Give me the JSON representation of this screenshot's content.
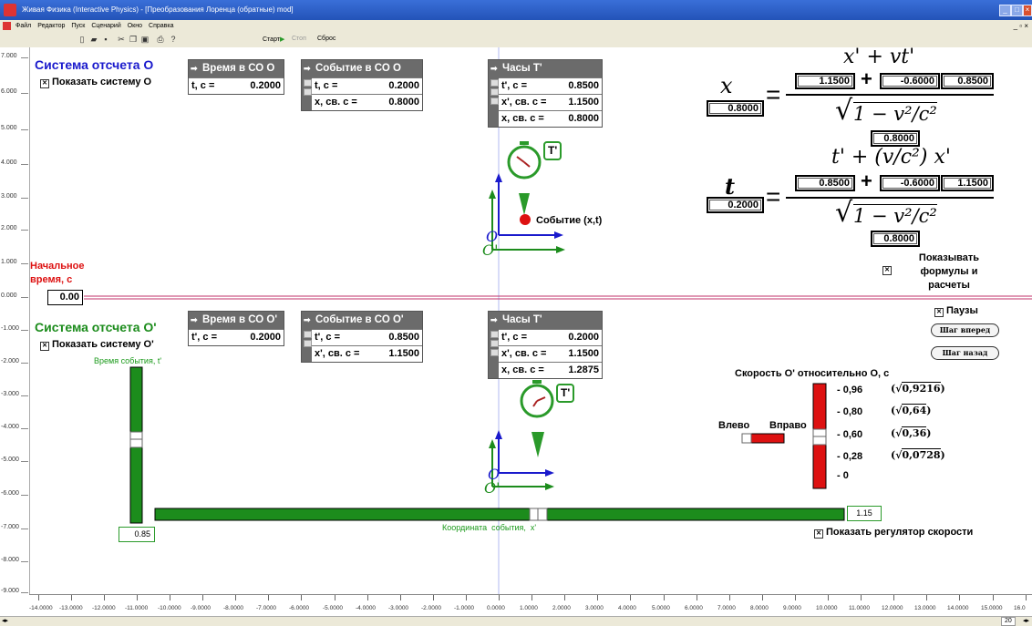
{
  "window": {
    "title": "Живая Физика (Interactive Physics) - [Преобразования Лоренца (обратные) mod]"
  },
  "menu": [
    "Файл",
    "Редактор",
    "Пуск",
    "Сценарий",
    "Окно",
    "Справка"
  ],
  "toolbar": {
    "start": "Старт",
    "stop": "Стоп",
    "reset": "Сброс"
  },
  "frame_o": {
    "heading": "Система отсчета O",
    "show_label": "Показать систему O",
    "time_meter": {
      "title": "Время в СО O",
      "label": "t, c =",
      "value": "0.2000"
    },
    "event_meter": {
      "title": "Событие в СО O",
      "rows": [
        {
          "label": "t, c =",
          "value": "0.2000"
        },
        {
          "label": "x, св. с =",
          "value": "0.8000"
        }
      ]
    },
    "clock_meter": {
      "title": "Часы T'",
      "rows": [
        {
          "label": "t', c =",
          "value": "0.8500"
        },
        {
          "label": "x', св. с =",
          "value": "1.1500"
        },
        {
          "label": "x, св. с =",
          "value": "0.8000"
        }
      ]
    },
    "clock_label": "T'",
    "event_label": "Событие (x,t)",
    "axis_o": "O",
    "axis_o_prime": "O'"
  },
  "formulas": {
    "x_var": "x",
    "x_result": "0.8000",
    "x_numerator": "x' + vt'",
    "x_n1": "1.1500",
    "x_n2": "-0.6000",
    "x_n3": "0.8500",
    "x_den_val": "0.8000",
    "t_var": "t",
    "t_result": "0.2000",
    "t_numerator": "t' + (v/c²) x'",
    "t_n1": "0.8500",
    "t_n2": "-0.6000",
    "t_n3": "1.1500",
    "t_den_val": "0.8000",
    "denominator": "1 − v²/c²",
    "plus": "+",
    "equals": "=",
    "sqrt": "√",
    "show_label": "Показывать формулы и расчеты"
  },
  "initial_time": {
    "label": "Начальное время, с",
    "value": "0.00"
  },
  "frame_op": {
    "heading": "Система отсчета O'",
    "show_label": "Показать систему O'",
    "time_meter": {
      "title": "Время в СО O'",
      "label": "t', c =",
      "value": "0.2000"
    },
    "event_meter": {
      "title": "Событие в СО O'",
      "rows": [
        {
          "label": "t', c =",
          "value": "0.8500"
        },
        {
          "label": "x', св. с =",
          "value": "1.1500"
        }
      ]
    },
    "clock_meter": {
      "title": "Часы T'",
      "rows": [
        {
          "label": "t', c =",
          "value": "0.2000"
        },
        {
          "label": "x', св. с =",
          "value": "1.1500"
        },
        {
          "label": "x, св. с =",
          "value": "1.2875"
        }
      ]
    },
    "clock_label": "T'",
    "event_time_label": "Время события, t'",
    "event_time_value": "0.85",
    "coord_label": "Координата  события,  x'",
    "coord_value": "1.15",
    "axis_o": "O",
    "axis_o_prime": "O'"
  },
  "controls": {
    "pauses_label": "Паузы",
    "step_forward": "Шаг вперед",
    "step_back": "Шаг назад",
    "speed_title": "Скорость O' относительно O, с",
    "left_label": "Влево",
    "right_label": "Вправо",
    "speed_marks": [
      "- 0,96",
      "- 0,80",
      "- 0,60",
      "- 0,28",
      "- 0"
    ],
    "sqrt_marks": [
      "0,9216",
      "0,64",
      "0,36",
      "0,0728"
    ],
    "show_speed_label": "Показать регулятор скорости"
  },
  "vruler": [
    "7.000",
    "6.000",
    "5.000",
    "4.000",
    "3.000",
    "2.000",
    "1.000",
    "0.000",
    "-1.000",
    "-2.000",
    "-3.000",
    "-4.000",
    "-5.000",
    "-6.000",
    "-7.000",
    "-8.000",
    "-9.000"
  ],
  "hruler": [
    "-14.0000",
    "-13.0000",
    "-12.0000",
    "-11.0000",
    "-10.0000",
    "-9.0000",
    "-8.0000",
    "-7.0000",
    "-6.0000",
    "-5.0000",
    "-4.0000",
    "-3.0000",
    "-2.0000",
    "-1.0000",
    "0.0000",
    "1.0000",
    "2.0000",
    "3.0000",
    "4.0000",
    "5.0000",
    "6.0000",
    "7.0000",
    "8.0000",
    "9.0000",
    "10.0000",
    "11.0000",
    "12.0000",
    "13.0000",
    "14.0000",
    "15.0000",
    "16.0"
  ],
  "zoom": "20",
  "colors": {
    "red": "#dd1111",
    "green": "#1c8c1c",
    "blue": "#1a1acc",
    "meter_header": "#6b6b6b"
  }
}
